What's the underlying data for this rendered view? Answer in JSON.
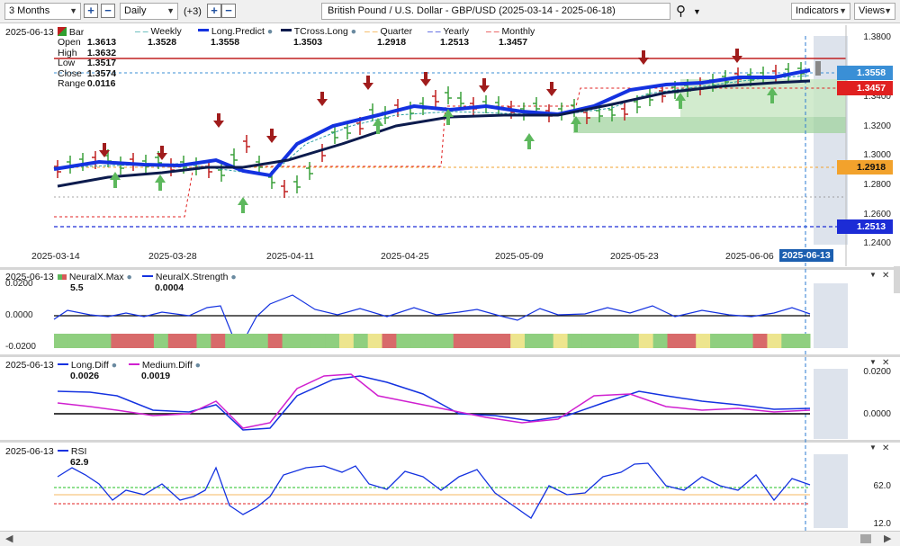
{
  "toolbar": {
    "period": "3 Months",
    "interval": "Daily",
    "extra": "(+3)",
    "title": "British Pound / U.S. Dollar - GBP/USD (2025-03-14 - 2025-06-18)",
    "indicators_label": "Indicators",
    "views_label": "Views"
  },
  "icons": [
    "plus-icon",
    "minus-icon",
    "search-icon",
    "chevron-down-icon",
    "close-icon",
    "arrow-left-icon",
    "arrow-right-icon"
  ],
  "colors": {
    "green_arrow": "#5db85d",
    "red_arrow": "#a01c1c",
    "long_predict": "#1432e0",
    "tcross": "#0c1b4d",
    "current_price_bg": "#3a8fd6",
    "monthly_bg": "#e02020",
    "quarter_bg": "#f2a22c",
    "yearly_bg": "#1c2cd6"
  },
  "main": {
    "date": "2025-06-13",
    "ohlc": {
      "open_label": "Open",
      "open": "1.3613",
      "high_label": "High",
      "high": "1.3632",
      "low_label": "Low",
      "low": "1.3517",
      "close_label": "Close",
      "close": "1.3574",
      "range_label": "Range",
      "range": "0.0116"
    },
    "legend": [
      {
        "name": "Bar",
        "value": ""
      },
      {
        "name": "Weekly",
        "value": "1.3528"
      },
      {
        "name": "Long.Predict",
        "value": "1.3558"
      },
      {
        "name": "TCross.Long",
        "value": "1.3503"
      },
      {
        "name": "Quarter",
        "value": "1.2918"
      },
      {
        "name": "Yearly",
        "value": "1.2513"
      },
      {
        "name": "Monthly",
        "value": "1.3457"
      }
    ],
    "y_ticks": [
      "1.3800",
      "1.3400",
      "1.3200",
      "1.3000",
      "1.2800",
      "1.2600",
      "1.2400"
    ],
    "price_tags": {
      "current": "1.3558",
      "monthly": "1.3457",
      "quarter": "1.2918",
      "yearly": "1.2513"
    },
    "x_ticks": [
      "2025-03-14",
      "2025-03-28",
      "2025-04-11",
      "2025-04-25",
      "2025-05-09",
      "2025-05-23",
      "2025-06-06"
    ],
    "x_highlight": "2025-06-13"
  },
  "neural": {
    "date": "2025-06-13",
    "legend": [
      {
        "name": "NeuralX.Max",
        "value": "5.5"
      },
      {
        "name": "NeuralX.Strength",
        "value": "0.0004"
      }
    ],
    "y_ticks": [
      "0.0200",
      "0.0000",
      "-0.0200"
    ]
  },
  "diff": {
    "date": "2025-06-13",
    "legend": [
      {
        "name": "Long.Diff",
        "value": "0.0026"
      },
      {
        "name": "Medium.Diff",
        "value": "0.0019"
      }
    ],
    "y_ticks": [
      "0.0200",
      "0.0000"
    ]
  },
  "rsi": {
    "date": "2025-06-13",
    "legend": [
      {
        "name": "RSI",
        "value": "62.9"
      }
    ],
    "y_ticks": [
      "62.0",
      "12.0"
    ]
  }
}
